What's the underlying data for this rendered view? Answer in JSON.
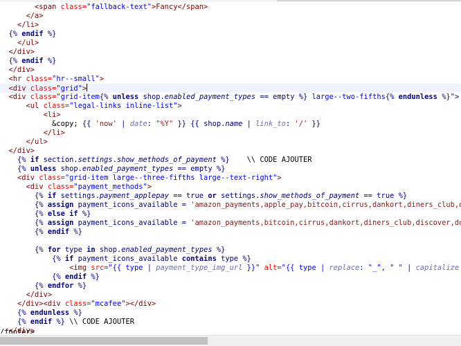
{
  "editor": {
    "current_line": 9,
    "lines": [
      [
        [
          "        ",
          "txt"
        ],
        [
          "<span ",
          "tag"
        ],
        [
          "class=",
          "attr"
        ],
        [
          "\"fallback-text\"",
          "val"
        ],
        [
          ">Fancy</span>",
          "tag"
        ]
      ],
      [
        [
          "      ",
          "txt"
        ],
        [
          "</a>",
          "tag"
        ]
      ],
      [
        [
          "    ",
          "txt"
        ],
        [
          "</li>",
          "tag"
        ]
      ],
      [
        [
          "  ",
          "txt"
        ],
        [
          "{% ",
          "liq"
        ],
        [
          "endif",
          "kw"
        ],
        [
          " %}",
          "liq"
        ]
      ],
      [
        [
          "    ",
          "txt"
        ],
        [
          "</ul>",
          "tag"
        ]
      ],
      [
        [
          "  ",
          "txt"
        ],
        [
          "</div>",
          "tag"
        ]
      ],
      [
        [
          "  ",
          "txt"
        ],
        [
          "{% ",
          "liq"
        ],
        [
          "endif",
          "kw"
        ],
        [
          " %}",
          "liq"
        ]
      ],
      [
        [
          "  ",
          "txt"
        ],
        [
          "</div>",
          "tag"
        ]
      ],
      [
        [
          "  ",
          "txt"
        ],
        [
          "<hr ",
          "tag"
        ],
        [
          "class=",
          "attr"
        ],
        [
          "\"hr--small\"",
          "val"
        ],
        [
          ">",
          "tag"
        ]
      ],
      [
        [
          "  ",
          "txt"
        ],
        [
          "<div ",
          "tag"
        ],
        [
          "class=",
          "attr"
        ],
        [
          "\"grid\"",
          "val"
        ],
        [
          ">",
          "tag"
        ]
      ],
      [
        [
          "  ",
          "txt"
        ],
        [
          "<div ",
          "tag"
        ],
        [
          "class=",
          "attr"
        ],
        [
          "\"grid-item",
          "val"
        ],
        [
          "{% ",
          "liq"
        ],
        [
          "unless",
          "kw"
        ],
        [
          " shop.",
          "liq"
        ],
        [
          "enabled_payment_types",
          "prop"
        ],
        [
          " == empty %}",
          "liq"
        ],
        [
          " large--two-fifths",
          "val"
        ],
        [
          "{% ",
          "liq"
        ],
        [
          "endunless",
          "kw"
        ],
        [
          " %}\">",
          "liq"
        ]
      ],
      [
        [
          "      ",
          "txt"
        ],
        [
          "<ul ",
          "tag"
        ],
        [
          "class=",
          "attr"
        ],
        [
          "\"legal-links inline-list\"",
          "val"
        ],
        [
          ">",
          "tag"
        ]
      ],
      [
        [
          "          ",
          "txt"
        ],
        [
          "<li>",
          "tag"
        ]
      ],
      [
        [
          "            &copy; ",
          "txt"
        ],
        [
          "{{ ",
          "liq"
        ],
        [
          "'now'",
          "str"
        ],
        [
          " | ",
          "liq"
        ],
        [
          "date",
          "filter"
        ],
        [
          ": ",
          "liq"
        ],
        [
          "\"%Y\"",
          "str"
        ],
        [
          " }} {{ shop.",
          "liq"
        ],
        [
          "name",
          "prop"
        ],
        [
          " | ",
          "liq"
        ],
        [
          "link_to",
          "filter"
        ],
        [
          ": ",
          "liq"
        ],
        [
          "'/'",
          "str"
        ],
        [
          " }}",
          "liq"
        ]
      ],
      [
        [
          "          ",
          "txt"
        ],
        [
          "</li>",
          "tag"
        ]
      ],
      [
        [
          "      ",
          "txt"
        ],
        [
          "</ul>",
          "tag"
        ]
      ],
      [
        [
          "  ",
          "txt"
        ],
        [
          "</div>",
          "tag"
        ]
      ],
      [
        [
          "    ",
          "txt"
        ],
        [
          "{% ",
          "liq"
        ],
        [
          "if",
          "kw"
        ],
        [
          " section.",
          "liq"
        ],
        [
          "settings",
          "prop"
        ],
        [
          ".",
          "liq"
        ],
        [
          "show_methods_of_payment",
          "prop"
        ],
        [
          " %}",
          "liq"
        ],
        [
          "    \\\\ CODE AJOUTER",
          "txt"
        ]
      ],
      [
        [
          "    ",
          "txt"
        ],
        [
          "{% ",
          "liq"
        ],
        [
          "unless",
          "kw"
        ],
        [
          " shop.",
          "liq"
        ],
        [
          "enabled_payment_types",
          "prop"
        ],
        [
          " == empty %}",
          "liq"
        ]
      ],
      [
        [
          "    ",
          "txt"
        ],
        [
          "<div ",
          "tag"
        ],
        [
          "class=",
          "attr"
        ],
        [
          "\"grid-item large--three-fifths large--text-right\"",
          "val"
        ],
        [
          ">",
          "tag"
        ]
      ],
      [
        [
          "      ",
          "txt"
        ],
        [
          "<div ",
          "tag"
        ],
        [
          "class=",
          "attr"
        ],
        [
          "\"payment_methods\"",
          "val"
        ],
        [
          ">",
          "tag"
        ]
      ],
      [
        [
          "        ",
          "txt"
        ],
        [
          "{% ",
          "liq"
        ],
        [
          "if",
          "kw"
        ],
        [
          " settings.",
          "liq"
        ],
        [
          "payment_applepay",
          "prop"
        ],
        [
          " == true ",
          "liq"
        ],
        [
          "or",
          "kw"
        ],
        [
          " settings.",
          "liq"
        ],
        [
          "show_methods_of_payment",
          "prop"
        ],
        [
          " == true %}",
          "liq"
        ]
      ],
      [
        [
          "        ",
          "txt"
        ],
        [
          "{% ",
          "liq"
        ],
        [
          "assign",
          "kw"
        ],
        [
          " payment_icons_available = ",
          "liq"
        ],
        [
          "'amazon_payments,apple_pay,bitcoin,cirrus,dankort,diners_club,discover'",
          "str"
        ]
      ],
      [
        [
          "        ",
          "txt"
        ],
        [
          "{% ",
          "liq"
        ],
        [
          "else if",
          "kw"
        ],
        [
          " %}",
          "liq"
        ]
      ],
      [
        [
          "        ",
          "txt"
        ],
        [
          "{% ",
          "liq"
        ],
        [
          "assign",
          "kw"
        ],
        [
          " payment_icons_available = ",
          "liq"
        ],
        [
          "'amazon_payments,bitcoin,cirrus,dankort,diners_club,discover,dogecoin'",
          "str"
        ]
      ],
      [
        [
          "        ",
          "txt"
        ],
        [
          "{% ",
          "liq"
        ],
        [
          "endif",
          "kw"
        ],
        [
          " %}",
          "liq"
        ]
      ],
      [
        [
          "",
          "txt"
        ]
      ],
      [
        [
          "        ",
          "txt"
        ],
        [
          "{% ",
          "liq"
        ],
        [
          "for",
          "kw"
        ],
        [
          " type ",
          "liq"
        ],
        [
          "in",
          "kw"
        ],
        [
          " shop.",
          "liq"
        ],
        [
          "enabled_payment_types",
          "prop"
        ],
        [
          " %}",
          "liq"
        ]
      ],
      [
        [
          "            ",
          "txt"
        ],
        [
          "{% ",
          "liq"
        ],
        [
          "if",
          "kw"
        ],
        [
          " payment_icons_available ",
          "liq"
        ],
        [
          "contains",
          "kw"
        ],
        [
          " type %}",
          "liq"
        ]
      ],
      [
        [
          "                ",
          "txt"
        ],
        [
          "<img ",
          "tag"
        ],
        [
          "src=",
          "attr"
        ],
        [
          "\"{{ type | ",
          "val"
        ],
        [
          "payment_type_img_url",
          "filter"
        ],
        [
          " }}\"",
          "val"
        ],
        [
          " alt=",
          "attr"
        ],
        [
          "\"{{ type | ",
          "val"
        ],
        [
          "replace",
          "filter"
        ],
        [
          ": \"_\", \" \" | ",
          "val"
        ],
        [
          "capitalize",
          "filter"
        ],
        [
          " }}\" />",
          "val"
        ]
      ],
      [
        [
          "            ",
          "txt"
        ],
        [
          "{% ",
          "liq"
        ],
        [
          "endif",
          "kw"
        ],
        [
          " %}",
          "liq"
        ]
      ],
      [
        [
          "        ",
          "txt"
        ],
        [
          "{% ",
          "liq"
        ],
        [
          "endfor",
          "kw"
        ],
        [
          " %}",
          "liq"
        ]
      ],
      [
        [
          "      ",
          "txt"
        ],
        [
          "</div>",
          "tag"
        ]
      ],
      [
        [
          "    ",
          "txt"
        ],
        [
          "</div><div ",
          "tag"
        ],
        [
          "class=",
          "attr"
        ],
        [
          "\"mcafee\"",
          "val"
        ],
        [
          "></div>",
          "tag"
        ]
      ],
      [
        [
          "    ",
          "txt"
        ],
        [
          "{% ",
          "liq"
        ],
        [
          "endunless",
          "kw"
        ],
        [
          " %}",
          "liq"
        ]
      ],
      [
        [
          "    ",
          "txt"
        ],
        [
          "{% ",
          "liq"
        ],
        [
          "endif",
          "kw"
        ],
        [
          " %}",
          "liq"
        ],
        [
          " \\\\ CODE AJOUTER",
          "txt"
        ]
      ],
      [
        [
          "  ",
          "txt"
        ],
        [
          "</div>",
          "tag"
        ]
      ],
      [
        [
          "</div>",
          "tag"
        ]
      ],
      [
        [
          "",
          "txt"
        ]
      ],
      [
        [
          "",
          "txt"
        ]
      ],
      [
        [
          "/footer>",
          "txt"
        ]
      ]
    ]
  },
  "scrollbar": {
    "horizontal_position": 0.0
  }
}
